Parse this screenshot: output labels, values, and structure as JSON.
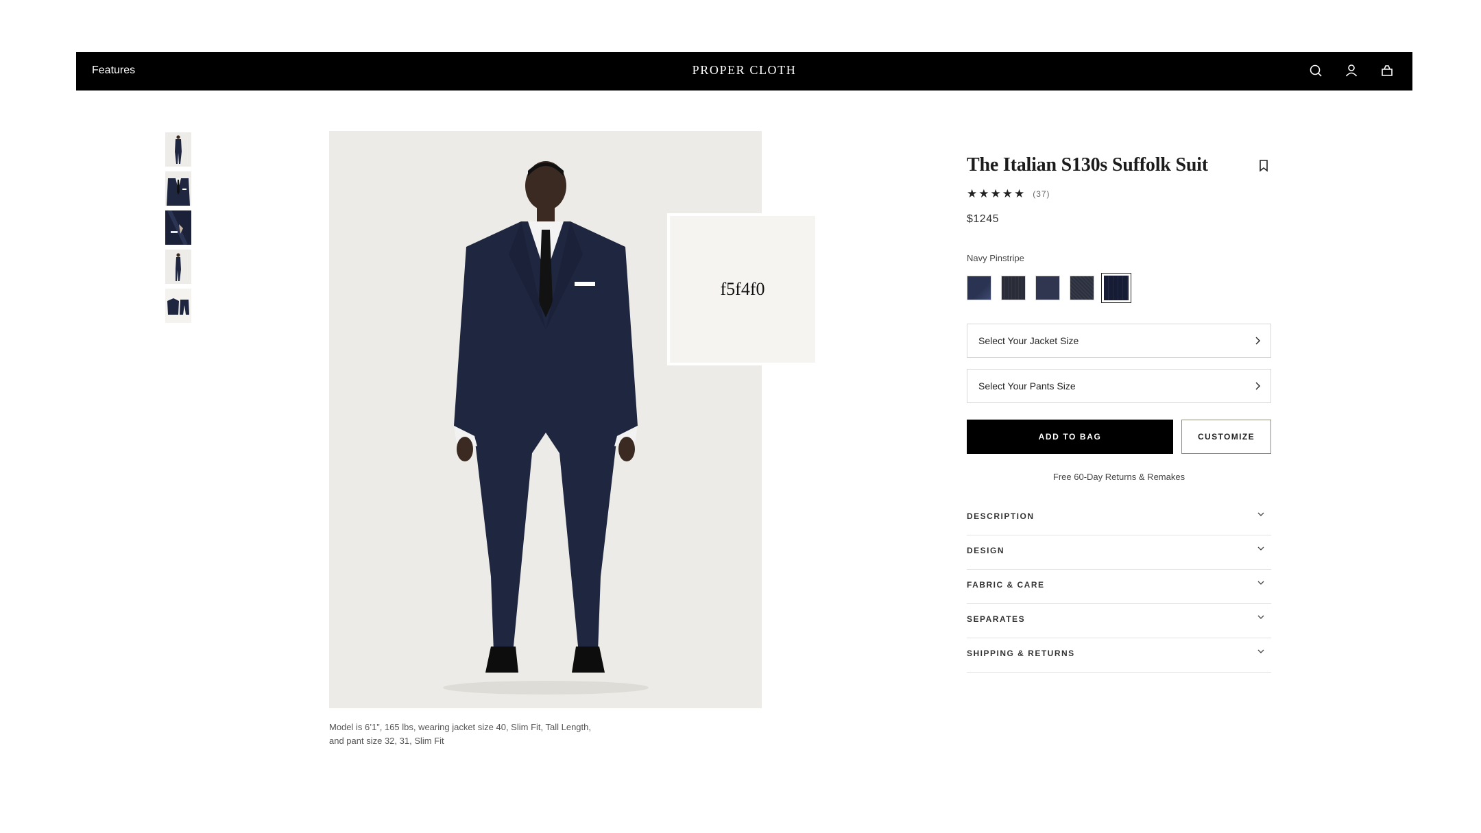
{
  "header": {
    "nav_link": "Features",
    "brand": "PROPER CLOTH",
    "icons": [
      "search-icon",
      "account-icon",
      "bag-icon"
    ]
  },
  "gallery": {
    "thumbnail_count": 5,
    "swatch_card_text": "f5f4f0",
    "caption_line1": "Model is 6’1”, 165 lbs, wearing jacket size 40, Slim Fit, Tall Length,",
    "caption_line2": "and pant size 32, 31, Slim Fit"
  },
  "product": {
    "title": "The Italian S130s Suffolk Suit",
    "stars": "★★★★★",
    "review_count": "(37)",
    "price": "$1245",
    "color_name": "Navy Pinstripe",
    "swatches": [
      {
        "color": "#2a3452"
      },
      {
        "color": "#2a2d38"
      },
      {
        "color": "#303550"
      },
      {
        "color": "#363a48"
      },
      {
        "color": "#161c33",
        "selected": true
      }
    ],
    "jacket_size_label": "Select Your Jacket Size",
    "pants_size_label": "Select Your Pants Size",
    "add_to_bag_label": "ADD TO BAG",
    "customize_label": "CUSTOMIZE",
    "returns_note": "Free 60-Day Returns & Remakes",
    "accordion": [
      {
        "label": "DESCRIPTION"
      },
      {
        "label": "DESIGN"
      },
      {
        "label": "FABRIC & CARE"
      },
      {
        "label": "SEPARATES"
      },
      {
        "label": "SHIPPING & RETURNS"
      }
    ]
  },
  "colors": {
    "header_bg": "#000000",
    "hero_bg": "#ecebe7",
    "suit_navy": "#1f2740",
    "swatch_card_bg": "#f5f4f0"
  }
}
